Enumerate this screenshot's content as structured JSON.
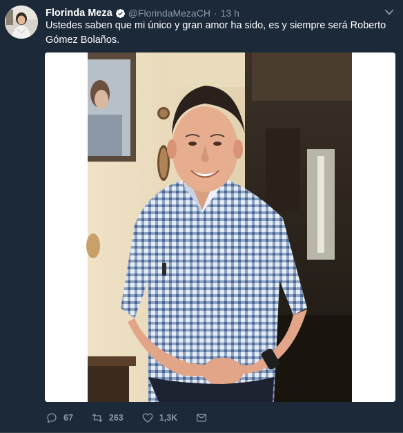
{
  "tweet": {
    "author_name": "Florinda Meza",
    "handle": "@FlorindaMezaCH",
    "separator": "·",
    "time": "13 h",
    "text": "Ustedes saben que mi único y gran amor ha sido, es y siempre será Roberto Gómez Bolaños.",
    "verified": true
  },
  "actions": {
    "replies": "67",
    "retweets": "263",
    "likes": "1,3K"
  },
  "icons": {
    "verified": "verified-badge-icon",
    "caret": "chevron-down-icon",
    "reply": "reply-icon",
    "retweet": "retweet-icon",
    "like": "heart-icon",
    "message": "envelope-icon"
  },
  "colors": {
    "background": "#1c2938",
    "text_primary": "#ffffff",
    "text_secondary": "#8899a6",
    "verified": "#1da1f2"
  }
}
